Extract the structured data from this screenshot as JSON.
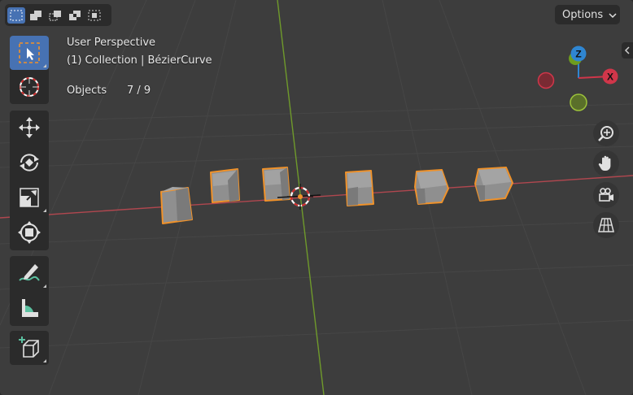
{
  "header": {
    "options_label": "Options",
    "select_modes": [
      "select-box-new-icon",
      "select-box-extend-icon",
      "select-box-subtract-icon",
      "select-box-difference-icon",
      "select-box-intersect-icon"
    ]
  },
  "overlay": {
    "view_name": "User Perspective",
    "collection_line": "(1) Collection | BézierCurve",
    "stats_label": "Objects",
    "stats_value": "7 / 9"
  },
  "gizmo": {
    "z_label": "Z",
    "x_label": "X",
    "colors": {
      "x": "#d0364a",
      "y": "#6e9c1e",
      "z": "#2f86d2"
    }
  },
  "toolbar": {
    "tools": [
      "select-box",
      "cursor",
      "move",
      "rotate",
      "scale",
      "transform",
      "annotate",
      "measure",
      "add-cube"
    ],
    "active_tool": "select-box"
  },
  "navigation": [
    "zoom",
    "pan",
    "camera",
    "perspective-toggle"
  ],
  "scene": {
    "selected_objects": 6,
    "selection_color": "#f0922a"
  }
}
